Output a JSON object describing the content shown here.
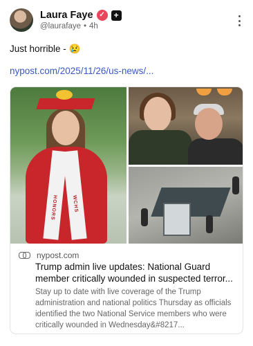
{
  "user": {
    "name": "Laura Faye",
    "handle": "@laurafaye",
    "separator": "•",
    "time": "4h",
    "verified_symbol": "✓",
    "plus_symbol": "+"
  },
  "post": {
    "text": "Just horrible - 😢",
    "link_text": "nypost.com/2025/11/26/us-news/..."
  },
  "card": {
    "domain": "nypost.com",
    "title": "Trump admin live updates: National Guard member critically wounded in suspected terror...",
    "description": "Stay up to date with live coverage of the Trump administration and national politics Thursday as officials identified the two National Service members who were critically wounded in Wednesday&#8217...",
    "stole_left": "HONORS",
    "stole_right": "WCHS"
  },
  "colors": {
    "verified": "#e8465b",
    "link": "#3a57c4"
  }
}
